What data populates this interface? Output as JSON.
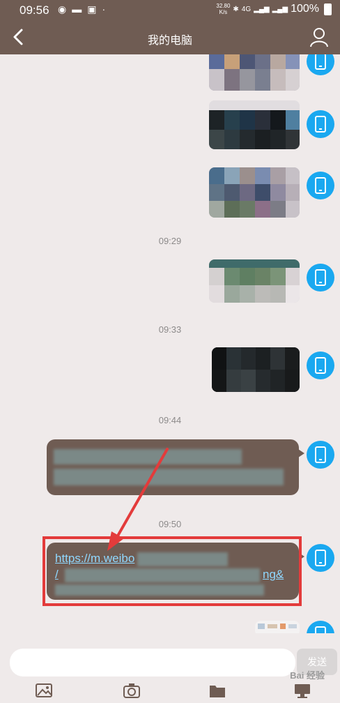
{
  "status_bar": {
    "time": "09:56",
    "network_speed": "32.80\nK/s",
    "network_type": "4G",
    "battery": "100%",
    "icons": [
      "globe-icon",
      "message-icon",
      "image-icon",
      "dot-icon"
    ]
  },
  "header": {
    "title": "我的电脑",
    "back_icon": "back-arrow-icon",
    "profile_icon": "person-icon"
  },
  "messages": {
    "timestamps": [
      "09:29",
      "09:33",
      "09:44",
      "09:50"
    ],
    "link_visible_text": "https://m.weibo",
    "link_fragment_end": "ng&",
    "link_fragment_slash": "/",
    "sender_icon": "phone-icon"
  },
  "annotation": {
    "highlight_color": "#e33b3b"
  },
  "composer": {
    "placeholder": "",
    "send_label": "发送"
  },
  "toolbar": {
    "items": [
      "image-icon",
      "camera-icon",
      "folder-icon",
      "computer-icon"
    ]
  },
  "watermark": "Bai 经验"
}
